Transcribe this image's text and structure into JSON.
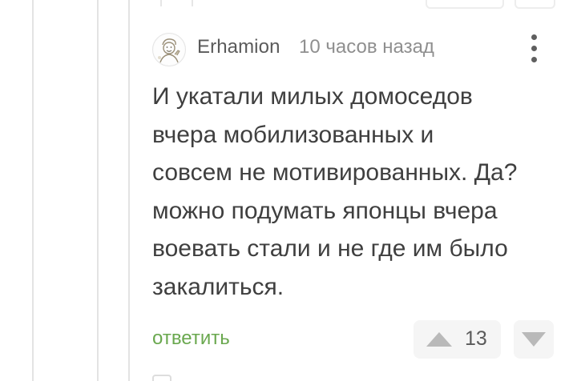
{
  "comment": {
    "author": "Erhamion",
    "time": "10 часов назад",
    "text": "И укатали милых домоседов\nвчера мобилизованных и\nсовсем не мотивированных. Да?\nможно подумать японцы вчера\nвоевать стали и не где им было\nзакалиться.",
    "reply_label": "ответить",
    "rating": "13"
  },
  "icons": {
    "avatar": "fallout-vault-boy-avatar",
    "more": "vertical-ellipsis-icon",
    "upvote": "triangle-up-icon",
    "downvote": "triangle-down-icon"
  },
  "colors": {
    "reply_link": "#6aa84f",
    "vote_bg": "#f5f5f5",
    "vote_icon": "#b9b9b9",
    "thread_line": "#e3e3e3"
  }
}
